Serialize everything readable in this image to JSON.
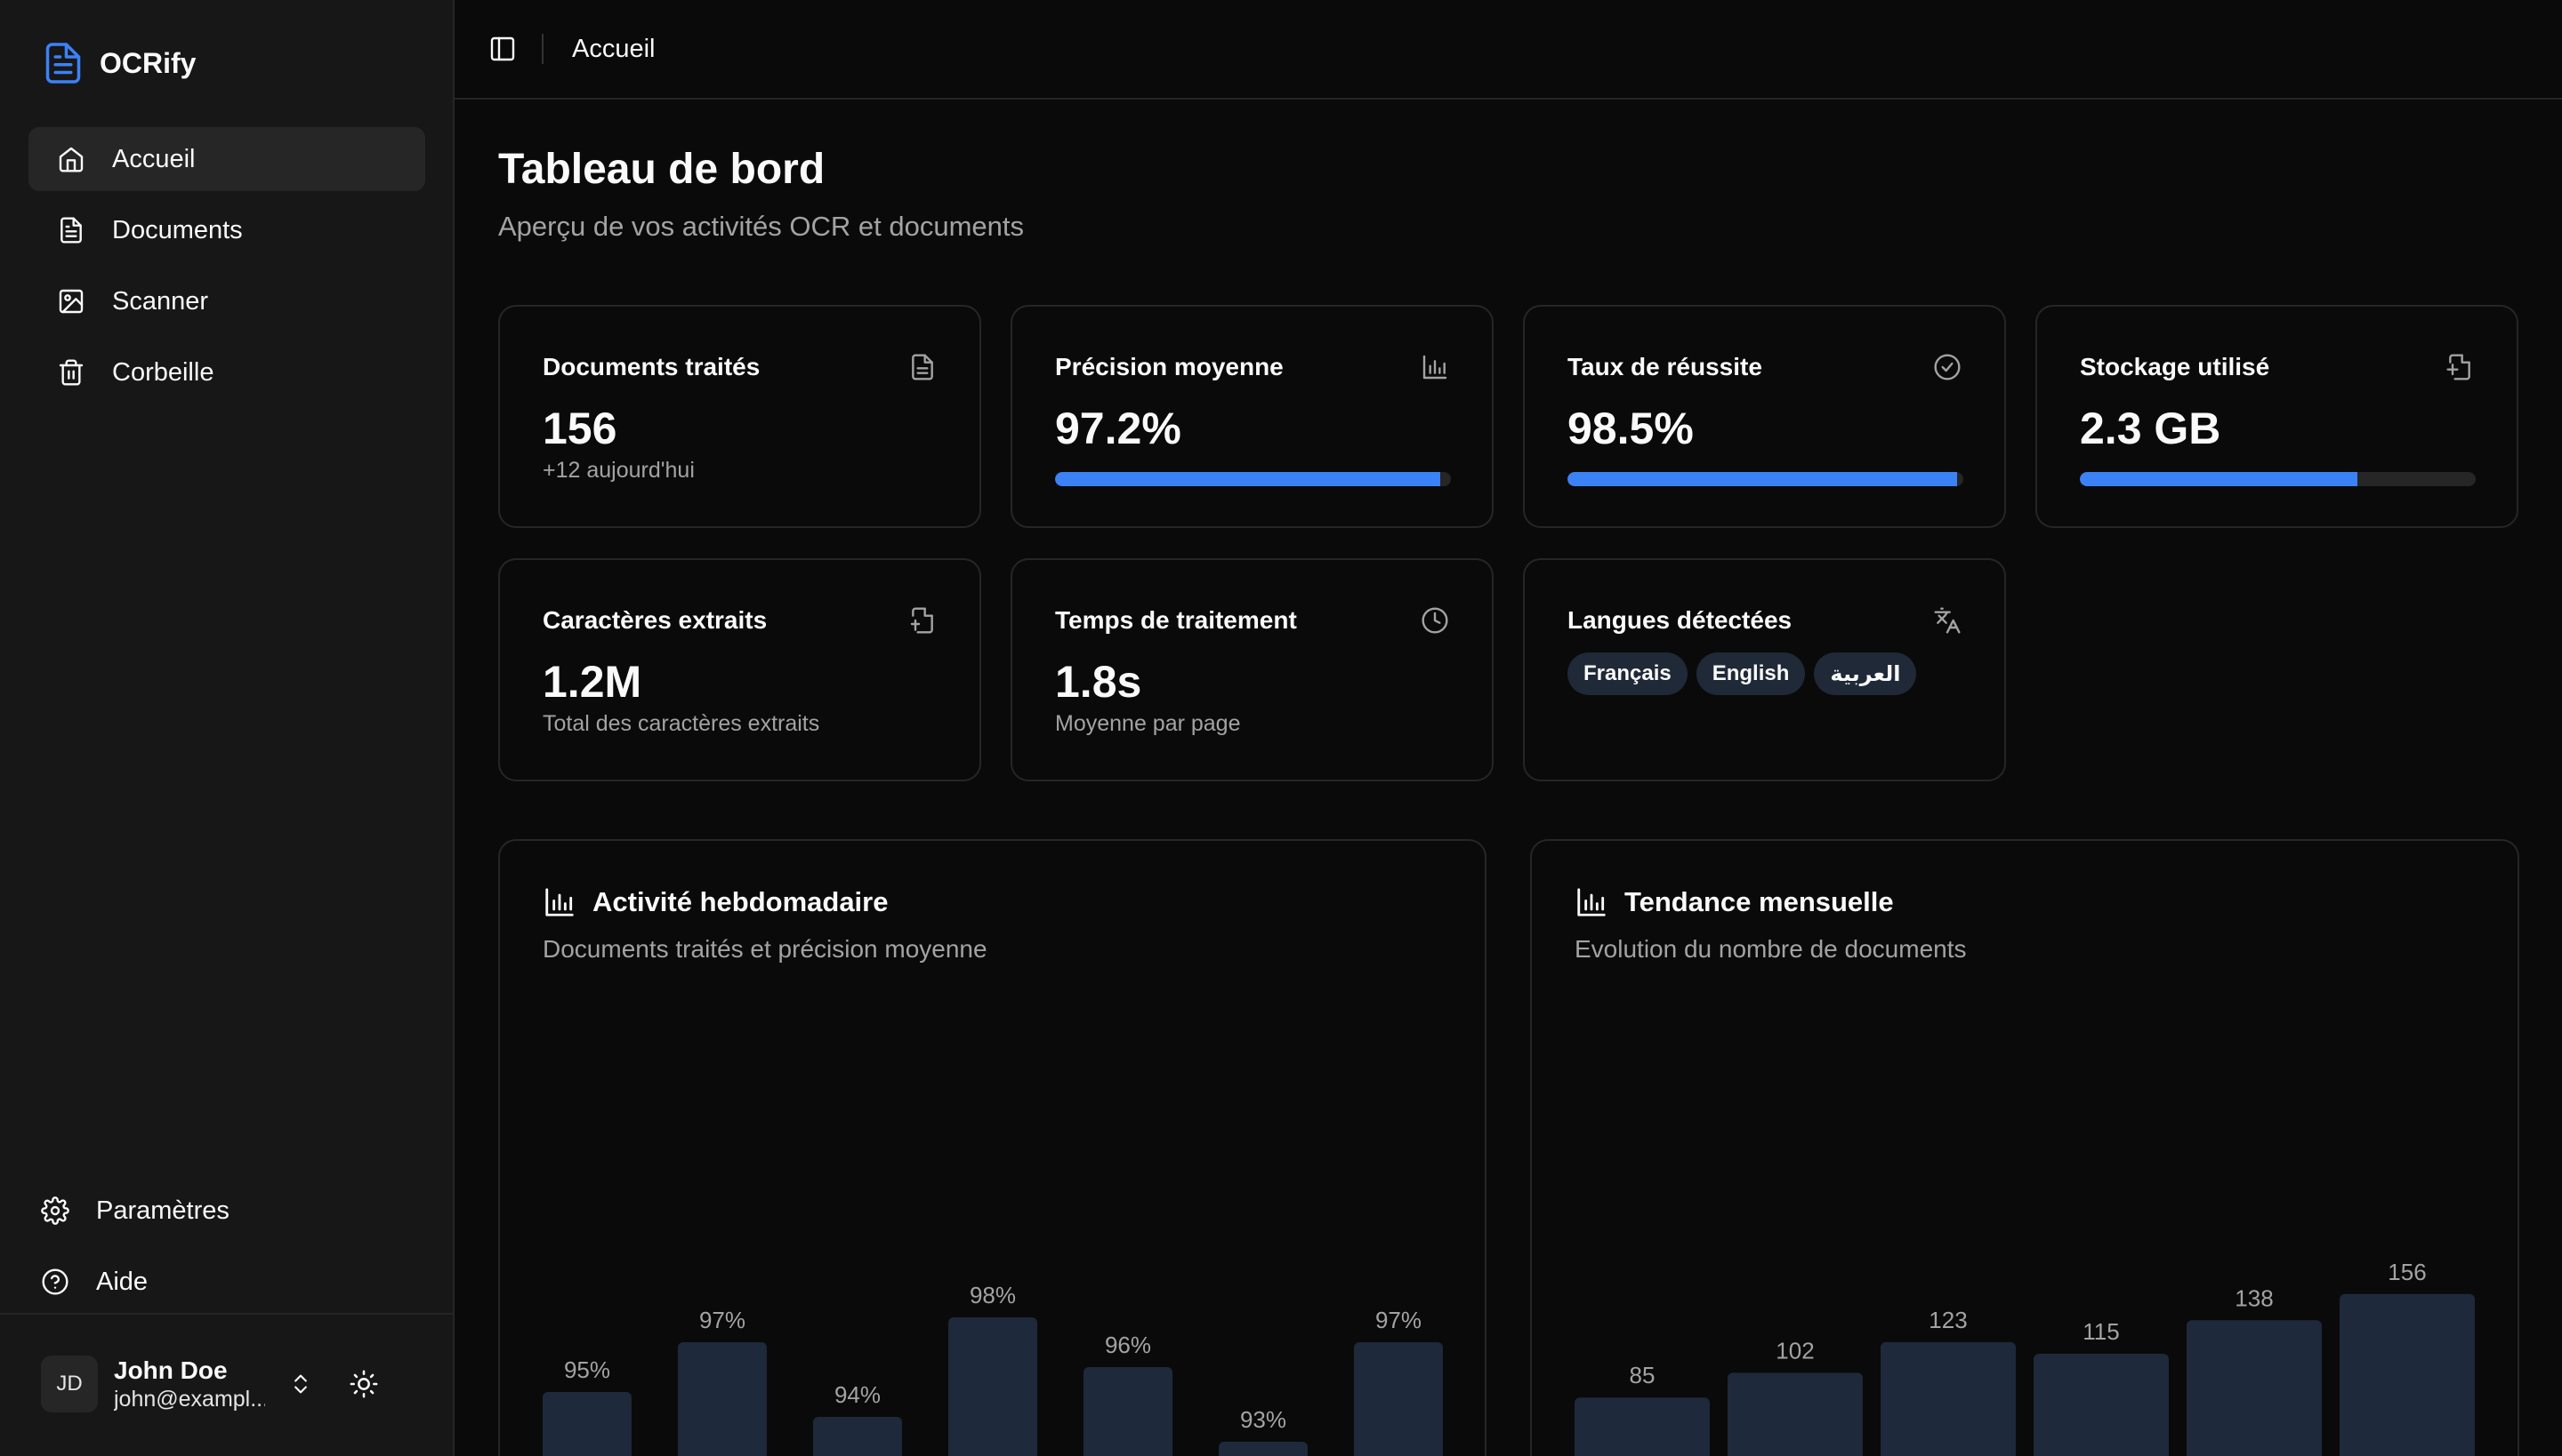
{
  "app": {
    "name": "OCRify"
  },
  "sidebar": {
    "items": [
      {
        "label": "Accueil",
        "icon": "home-icon",
        "active": true
      },
      {
        "label": "Documents",
        "icon": "document-icon",
        "active": false
      },
      {
        "label": "Scanner",
        "icon": "image-icon",
        "active": false
      },
      {
        "label": "Corbeille",
        "icon": "trash-icon",
        "active": false
      }
    ],
    "bottom": [
      {
        "label": "Paramètres",
        "icon": "gear-icon"
      },
      {
        "label": "Aide",
        "icon": "help-icon"
      }
    ],
    "user": {
      "initials": "JD",
      "name": "John Doe",
      "email": "john@exampl..."
    }
  },
  "topbar": {
    "breadcrumb": "Accueil"
  },
  "page": {
    "title": "Tableau de bord",
    "subtitle": "Aperçu de vos activités OCR et documents"
  },
  "stats": {
    "documents": {
      "title": "Documents traités",
      "value": "156",
      "sub": "+12 aujourd'hui"
    },
    "precision": {
      "title": "Précision moyenne",
      "value": "97.2%",
      "progress": 0.972
    },
    "success": {
      "title": "Taux de réussite",
      "value": "98.5%",
      "progress": 0.985
    },
    "storage": {
      "title": "Stockage utilisé",
      "value": "2.3 GB",
      "progress": 0.7
    },
    "characters": {
      "title": "Caractères extraits",
      "value": "1.2M",
      "sub": "Total des caractères extraits"
    },
    "time": {
      "title": "Temps de traitement",
      "value": "1.8s",
      "sub": "Moyenne par page"
    },
    "languages": {
      "title": "Langues détectées",
      "chips": [
        "Français",
        "English",
        "العربية"
      ]
    }
  },
  "colors": {
    "accent": "#3b82f6",
    "bar": "#1e293b",
    "card_border": "#262626"
  },
  "chart_data": [
    {
      "type": "bar",
      "title": "Activité hebdomadaire",
      "subtitle": "Documents traités et précision moyenne",
      "labels": [
        "95%",
        "97%",
        "94%",
        "98%",
        "96%",
        "93%",
        "97%"
      ],
      "values": [
        95,
        97,
        94,
        98,
        96,
        93,
        97
      ]
    },
    {
      "type": "bar",
      "title": "Tendance mensuelle",
      "subtitle": "Evolution du nombre de documents",
      "labels": [
        "85",
        "102",
        "123",
        "115",
        "138",
        "156"
      ],
      "values": [
        85,
        102,
        123,
        115,
        138,
        156
      ]
    }
  ]
}
